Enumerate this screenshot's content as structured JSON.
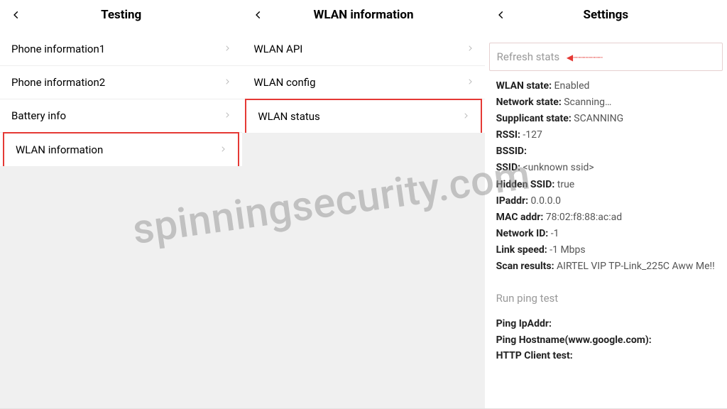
{
  "watermark": "spinningsecurity.com",
  "panel1": {
    "title": "Testing",
    "items": [
      {
        "label": "Phone information1",
        "highlight": false
      },
      {
        "label": "Phone information2",
        "highlight": false
      },
      {
        "label": "Battery info",
        "highlight": false
      },
      {
        "label": "WLAN information",
        "highlight": true
      }
    ]
  },
  "panel2": {
    "title": "WLAN information",
    "items": [
      {
        "label": "WLAN API",
        "highlight": false
      },
      {
        "label": "WLAN config",
        "highlight": false
      },
      {
        "label": "WLAN status",
        "highlight": true
      }
    ]
  },
  "panel3": {
    "title": "Settings",
    "refresh_label": "Refresh stats",
    "stats": [
      {
        "label": "WLAN state:",
        "value": " Enabled"
      },
      {
        "label": "Network state:",
        "value": " Scanning…"
      },
      {
        "label": "Supplicant state:",
        "value": " SCANNING"
      },
      {
        "label": "RSSI:",
        "value": " -127"
      },
      {
        "label": "BSSID:",
        "value": ""
      },
      {
        "label": "SSID:",
        "value": " <unknown ssid>"
      },
      {
        "label": "Hidden SSID:",
        "value": " true"
      },
      {
        "label": "IPaddr:",
        "value": " 0.0.0.0"
      },
      {
        "label": "MAC addr:",
        "value": " 78:02:f8:88:ac:ad"
      },
      {
        "label": "Network ID:",
        "value": " -1"
      },
      {
        "label": "Link speed:",
        "value": " -1 Mbps"
      },
      {
        "label": "Scan results:",
        "value": " AIRTEL VIP TP-Link_225C Aww Me!!"
      }
    ],
    "run_ping_label": "Run ping test",
    "ping": [
      {
        "label": "Ping IpAddr:"
      },
      {
        "label": "Ping Hostname(www.google.com):"
      },
      {
        "label": "HTTP Client test:"
      }
    ]
  }
}
